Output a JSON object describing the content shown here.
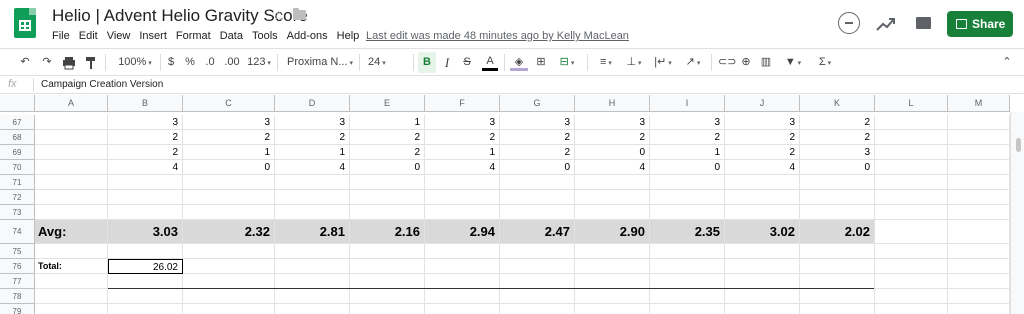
{
  "app": {
    "title": "Helio | Advent Helio Gravity Score",
    "last_edit": "Last edit was made 48 minutes ago by Kelly MacLean",
    "share_label": "Share",
    "accent_color": "#188038"
  },
  "menu": [
    "File",
    "Edit",
    "View",
    "Insert",
    "Format",
    "Data",
    "Tools",
    "Add-ons",
    "Help"
  ],
  "toolbar": {
    "zoom": "100%",
    "currency": "$",
    "percent": "%",
    "decrease_decimal": ".0",
    "increase_decimal": ".00",
    "more_formats": "123",
    "font": "Proxima N...",
    "font_size": "24",
    "bold": "B",
    "italic": "I",
    "strike": "S",
    "text_color": "A",
    "sum": "Σ"
  },
  "formula_bar": {
    "fx": "fx",
    "value": "Campaign Creation Version"
  },
  "columns": [
    "A",
    "B",
    "C",
    "D",
    "E",
    "F",
    "G",
    "H",
    "I",
    "J",
    "K",
    "L",
    "M"
  ],
  "rows": [
    {
      "num": "67",
      "cells": [
        "",
        "3",
        "3",
        "3",
        "1",
        "3",
        "3",
        "3",
        "3",
        "3",
        "2",
        "",
        ""
      ]
    },
    {
      "num": "68",
      "cells": [
        "",
        "2",
        "2",
        "2",
        "2",
        "2",
        "2",
        "2",
        "2",
        "2",
        "2",
        "",
        ""
      ]
    },
    {
      "num": "69",
      "cells": [
        "",
        "2",
        "1",
        "1",
        "2",
        "1",
        "2",
        "0",
        "1",
        "2",
        "3",
        "",
        ""
      ]
    },
    {
      "num": "70",
      "cells": [
        "",
        "4",
        "0",
        "4",
        "0",
        "4",
        "0",
        "4",
        "0",
        "4",
        "0",
        "",
        ""
      ]
    },
    {
      "num": "71",
      "cells": [
        "",
        "",
        "",
        "",
        "",
        "",
        "",
        "",
        "",
        "",
        "",
        "",
        ""
      ]
    },
    {
      "num": "72",
      "cells": [
        "",
        "",
        "",
        "",
        "",
        "",
        "",
        "",
        "",
        "",
        "",
        "",
        ""
      ]
    },
    {
      "num": "73",
      "cells": [
        "",
        "",
        "",
        "",
        "",
        "",
        "",
        "",
        "",
        "",
        "",
        "",
        ""
      ]
    },
    {
      "num": "74",
      "cells": [
        "Avg:",
        "3.03",
        "2.32",
        "2.81",
        "2.16",
        "2.94",
        "2.47",
        "2.90",
        "2.35",
        "3.02",
        "2.02",
        "",
        ""
      ]
    },
    {
      "num": "75",
      "cells": [
        "",
        "",
        "",
        "",
        "",
        "",
        "",
        "",
        "",
        "",
        "",
        "",
        ""
      ]
    },
    {
      "num": "76",
      "cells": [
        "Total:",
        "26.02",
        "",
        "",
        "",
        "",
        "",
        "",
        "",
        "",
        "",
        "",
        ""
      ]
    },
    {
      "num": "77",
      "cells": [
        "",
        "",
        "",
        "",
        "",
        "",
        "",
        "",
        "",
        "",
        "",
        "",
        ""
      ]
    },
    {
      "num": "78",
      "cells": [
        "",
        "",
        "",
        "",
        "",
        "",
        "",
        "",
        "",
        "",
        "",
        "",
        ""
      ]
    },
    {
      "num": "79",
      "cells": [
        "",
        "",
        "",
        "",
        "",
        "",
        "",
        "",
        "",
        "",
        "",
        "",
        ""
      ]
    }
  ]
}
